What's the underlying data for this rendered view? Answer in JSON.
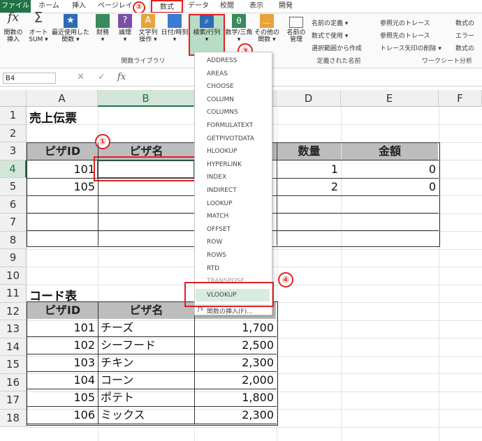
{
  "tabs": [
    "ファイル",
    "ホーム",
    "挿入",
    "ページレイ",
    "数式",
    "データ",
    "校閲",
    "表示",
    "開発"
  ],
  "ribbon": {
    "buttons": [
      {
        "label1": "関数の",
        "label2": "挿入"
      },
      {
        "label1": "オート",
        "label2": "SUM ▾"
      },
      {
        "label1": "最近使用した",
        "label2": "関数 ▾"
      },
      {
        "label1": "財務",
        "label2": "▾"
      },
      {
        "label1": "論理",
        "label2": "▾"
      },
      {
        "label1": "文字列",
        "label2": "操作 ▾"
      },
      {
        "label1": "日付/時刻",
        "label2": "▾"
      },
      {
        "label1": "検索/行列",
        "label2": "▾"
      },
      {
        "label1": "数学/三角",
        "label2": "▾"
      },
      {
        "label1": "その他の",
        "label2": "関数 ▾"
      },
      {
        "label1": "名前の",
        "label2": "管理"
      }
    ],
    "names_group": [
      "名前の定義 ▾",
      "数式で使用 ▾",
      "選択範囲から作成"
    ],
    "audit_group": [
      "参照元のトレース",
      "参照先のトレース",
      "トレース矢印の削除 ▾"
    ],
    "audit_group2": [
      "数式の",
      "エラー",
      "数式の"
    ],
    "group_labels": {
      "library": "関数ライブラリ",
      "names": "定義された名前",
      "audit": "ワークシート分析"
    },
    "fx_symbol": "fx"
  },
  "formula_bar": {
    "cell_ref": "B4",
    "cancel": "✕",
    "enter": "✓",
    "fx": "fx",
    "value": ""
  },
  "columns": [
    "A",
    "B",
    "C",
    "D",
    "E",
    "F"
  ],
  "rows": [
    "1",
    "2",
    "3",
    "4",
    "5",
    "6",
    "7",
    "8",
    "9",
    "10",
    "11",
    "12",
    "13",
    "14",
    "15",
    "16",
    "17",
    "18"
  ],
  "invoice": {
    "title": "売上伝票",
    "headers": {
      "id": "ピザID",
      "name": "ピザ名",
      "qty": "数量",
      "amount": "金額"
    },
    "rows": [
      {
        "id": "101",
        "qty": "1",
        "amount": "0"
      },
      {
        "id": "105",
        "qty": "2",
        "amount": "0"
      }
    ]
  },
  "code_table": {
    "title": "コード表",
    "headers": {
      "id": "ピザID",
      "name": "ピザ名"
    },
    "rows": [
      {
        "id": "101",
        "name": "チーズ",
        "price": "1,700"
      },
      {
        "id": "102",
        "name": "シーフード",
        "price": "2,500"
      },
      {
        "id": "103",
        "name": "チキン",
        "price": "2,300"
      },
      {
        "id": "104",
        "name": "コーン",
        "price": "2,000"
      },
      {
        "id": "105",
        "name": "ポテト",
        "price": "1,800"
      },
      {
        "id": "106",
        "name": "ミックス",
        "price": "2,300"
      }
    ]
  },
  "dropdown": {
    "items": [
      "ADDRESS",
      "AREAS",
      "CHOOSE",
      "COLUMN",
      "COLUMNS",
      "FORMULATEXT",
      "GETPIVOTDATA",
      "HLOOKUP",
      "HYPERLINK",
      "INDEX",
      "INDIRECT",
      "LOOKUP",
      "MATCH",
      "OFFSET",
      "ROW",
      "ROWS",
      "RTD",
      "TRANSPOSE",
      "VLOOKUP"
    ],
    "footer": "関数の挿入(F)..."
  },
  "markers": [
    "①",
    "②",
    "③",
    "④"
  ],
  "colors": {
    "accent": "#217346",
    "highlight": "#e02020",
    "selected_col": "#d2e5d8"
  }
}
